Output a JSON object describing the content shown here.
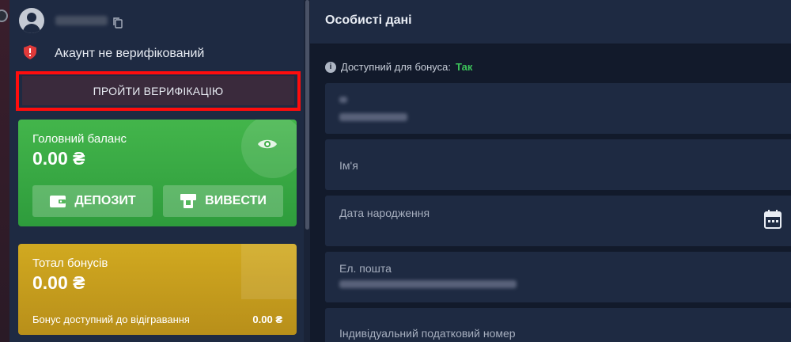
{
  "user": {
    "verification_status": "Акаунт не верифікований",
    "verify_button_label": "ПРОЙТИ ВЕРИФІКАЦІЮ"
  },
  "main_balance": {
    "label": "Головний баланс",
    "value": "0.00 ₴",
    "deposit_label": "ДЕПОЗИТ",
    "withdraw_label": "ВИВЕСТИ"
  },
  "bonus_balance": {
    "label": "Тотал бонусів",
    "value": "0.00 ₴",
    "available_label": "Бонус доступний до відігравання",
    "available_value": "0.00 ₴"
  },
  "personal": {
    "title": "Особисті дані",
    "bonus_eligible_label": "Доступний для бонуса:",
    "bonus_eligible_value": "Так",
    "fields": [
      {
        "label": "",
        "value_hidden": true
      },
      {
        "label": "Ім'я"
      },
      {
        "label": "Дата народження"
      },
      {
        "label": "Ел. пошта",
        "value_hidden": true
      },
      {
        "label": "Індивідуальний податковий номер"
      }
    ]
  },
  "colors": {
    "highlight": "#ff0d0d",
    "balance_card": "#3fae49",
    "bonus_card": "#c9a11f",
    "yes_text": "#3cc35a"
  },
  "icons": [
    "avatar",
    "copy-icon",
    "shield-icon",
    "eye-icon",
    "wallet-icon",
    "atm-icon",
    "info-icon",
    "calendar-icon"
  ]
}
